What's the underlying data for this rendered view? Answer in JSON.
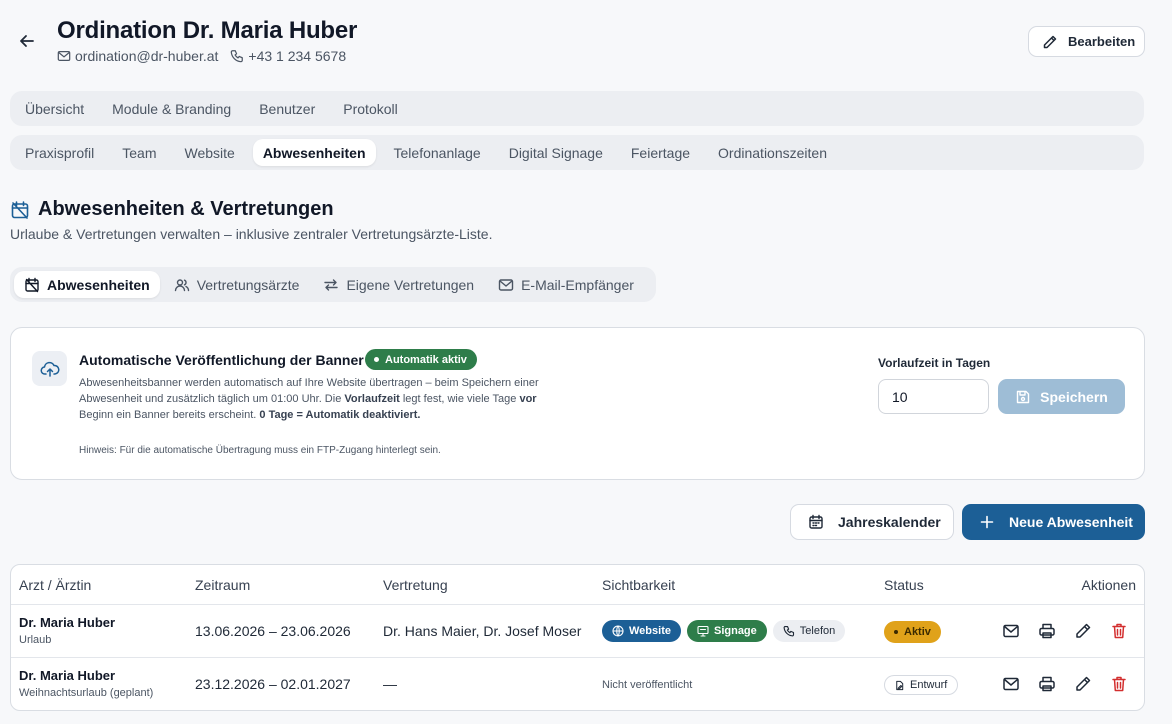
{
  "header": {
    "title": "Ordination Dr. Maria Huber",
    "email": "ordination@dr-huber.at",
    "phone": "+43 1 234 5678",
    "edit_label": "Bearbeiten"
  },
  "main_tabs": [
    {
      "label": "Übersicht",
      "active": false
    },
    {
      "label": "Module & Branding",
      "active": false
    },
    {
      "label": "Benutzer",
      "active": false
    },
    {
      "label": "Protokoll",
      "active": false
    }
  ],
  "sub_tabs": [
    {
      "label": "Praxisprofil",
      "active": false
    },
    {
      "label": "Team",
      "active": false
    },
    {
      "label": "Website",
      "active": false
    },
    {
      "label": "Abwesenheiten",
      "active": true
    },
    {
      "label": "Telefonanlage",
      "active": false
    },
    {
      "label": "Digital Signage",
      "active": false
    },
    {
      "label": "Feiertage",
      "active": false
    },
    {
      "label": "Ordinationszeiten",
      "active": false
    }
  ],
  "section": {
    "title": "Abwesenheiten & Vertretungen",
    "subtitle": "Urlaube & Vertretungen verwalten – inklusive zentraler Vertretungsärzte-Liste."
  },
  "pill_tabs": [
    {
      "label": "Abwesenheiten",
      "icon": "calendar-off-icon",
      "active": true
    },
    {
      "label": "Vertretungsärzte",
      "icon": "users-icon",
      "active": false
    },
    {
      "label": "Eigene Vertretungen",
      "icon": "swap-icon",
      "active": false
    },
    {
      "label": "E-Mail-Empfänger",
      "icon": "mail-icon",
      "active": false
    }
  ],
  "banner_card": {
    "title": "Automatische Veröffentlichung der Banner",
    "badge": "Automatik aktiv",
    "desc_1": "Abwesenheitsbanner werden automatisch auf Ihre Website übertragen – beim Speichern einer Abwesenheit und zusätzlich täglich um 01:00 Uhr. Die ",
    "desc_b1": "Vorlaufzeit",
    "desc_2": " legt fest, wie viele Tage ",
    "desc_b2": "vor",
    "desc_3": " Beginn ein Banner bereits erscheint. ",
    "desc_b3": "0 Tage = Automatik deaktiviert.",
    "hint": "Hinweis: Für die automatische Übertragung muss ein FTP-Zugang hinterlegt sein.",
    "lead_label": "Vorlaufzeit in Tagen",
    "lead_value": "10",
    "save_label": "Speichern"
  },
  "actions": {
    "calendar_label": "Jahreskalender",
    "new_label": "Neue Abwesenheit"
  },
  "table": {
    "headers": [
      "Arzt / Ärztin",
      "Zeitraum",
      "Vertretung",
      "Sichtbarkeit",
      "Status",
      "Aktionen"
    ],
    "rows": [
      {
        "name": "Dr. Maria Huber",
        "type": "Urlaub",
        "period": "13.06.2026 – 23.06.2026",
        "substitute": "Dr. Hans Maier, Dr. Josef Moser",
        "visibility": [
          "Website",
          "Signage",
          "Telefon"
        ],
        "status": "Aktiv"
      },
      {
        "name": "Dr. Maria Huber",
        "type": "Weihnachtsurlaub (geplant)",
        "period": "23.12.2026 – 02.01.2027",
        "substitute": "—",
        "visibility_text": "Nicht veröffentlicht",
        "status": "Entwurf"
      }
    ]
  },
  "colors": {
    "primary": "#1c5f96",
    "success": "#2e7d4a",
    "warning": "#e0a21a",
    "danger": "#d32f2f",
    "save_disabled": "#9ebdd6"
  }
}
